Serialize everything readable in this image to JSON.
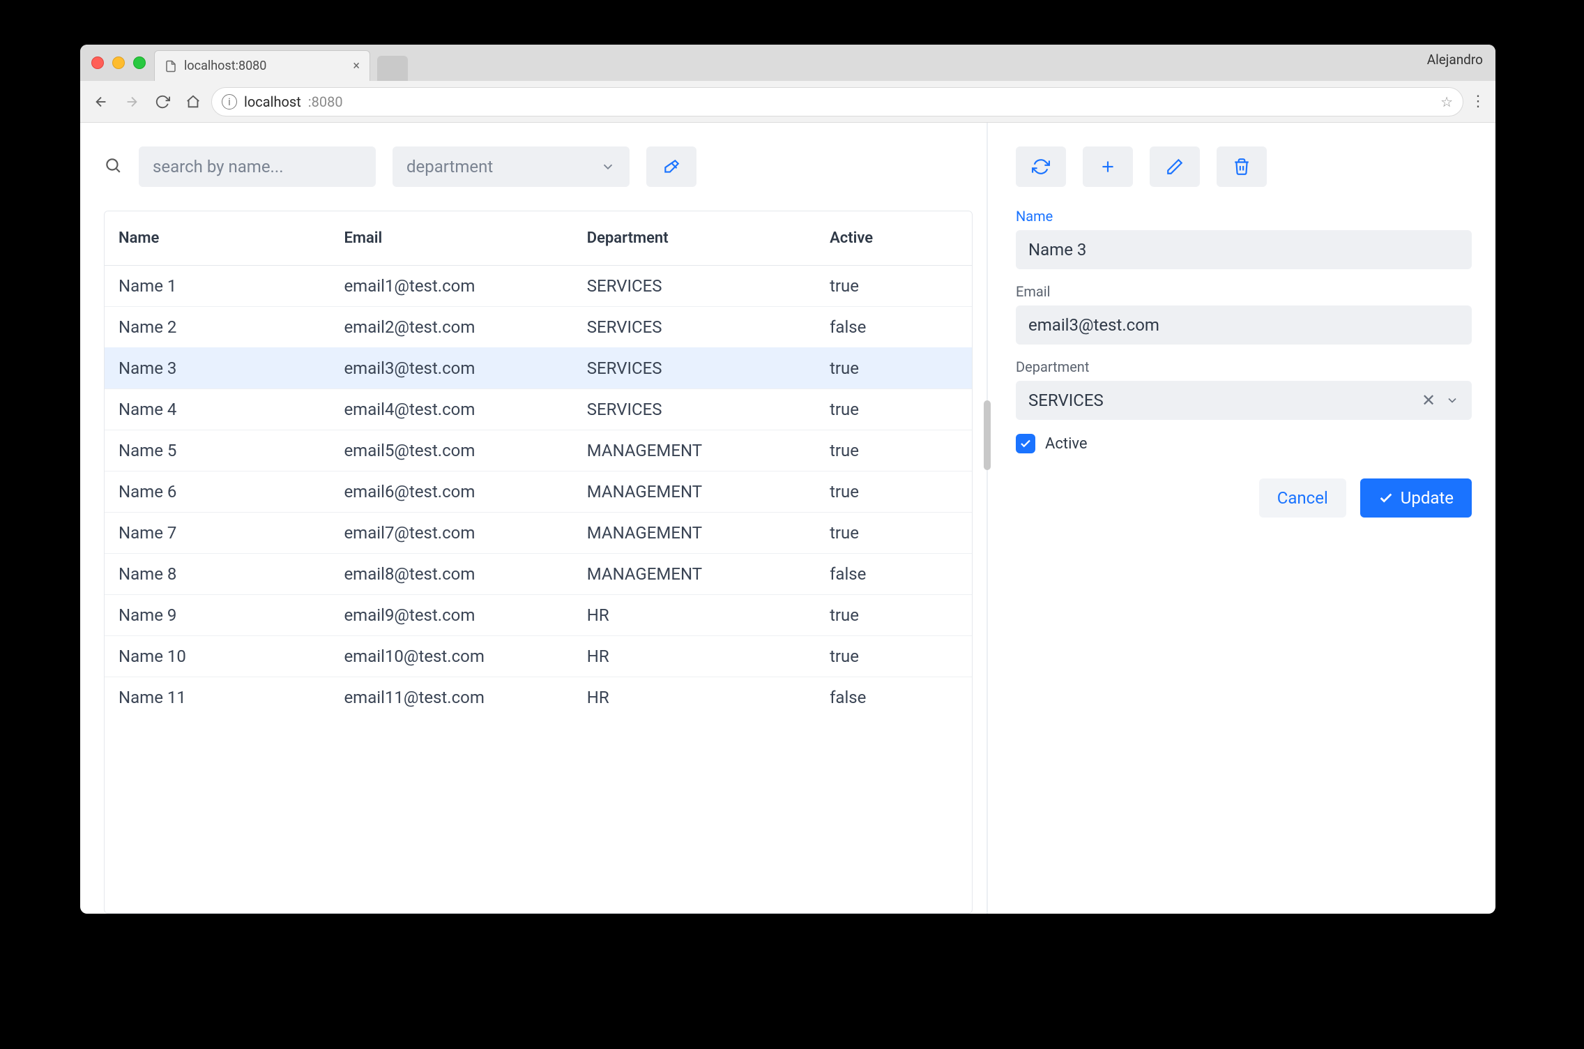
{
  "browser": {
    "tab_title": "localhost:8080",
    "profile_name": "Alejandro",
    "url_host": "localhost",
    "url_port": ":8080"
  },
  "toolbar": {
    "search_placeholder": "search by name...",
    "department_placeholder": "department"
  },
  "table": {
    "columns": [
      "Name",
      "Email",
      "Department",
      "Active"
    ],
    "selected_index": 2,
    "rows": [
      {
        "name": "Name 1",
        "email": "email1@test.com",
        "department": "SERVICES",
        "active": "true"
      },
      {
        "name": "Name 2",
        "email": "email2@test.com",
        "department": "SERVICES",
        "active": "false"
      },
      {
        "name": "Name 3",
        "email": "email3@test.com",
        "department": "SERVICES",
        "active": "true"
      },
      {
        "name": "Name 4",
        "email": "email4@test.com",
        "department": "SERVICES",
        "active": "true"
      },
      {
        "name": "Name 5",
        "email": "email5@test.com",
        "department": "MANAGEMENT",
        "active": "true"
      },
      {
        "name": "Name 6",
        "email": "email6@test.com",
        "department": "MANAGEMENT",
        "active": "true"
      },
      {
        "name": "Name 7",
        "email": "email7@test.com",
        "department": "MANAGEMENT",
        "active": "true"
      },
      {
        "name": "Name 8",
        "email": "email8@test.com",
        "department": "MANAGEMENT",
        "active": "false"
      },
      {
        "name": "Name 9",
        "email": "email9@test.com",
        "department": "HR",
        "active": "true"
      },
      {
        "name": "Name 10",
        "email": "email10@test.com",
        "department": "HR",
        "active": "true"
      },
      {
        "name": "Name 11",
        "email": "email11@test.com",
        "department": "HR",
        "active": "false"
      }
    ]
  },
  "form": {
    "labels": {
      "name": "Name",
      "email": "Email",
      "department": "Department",
      "active": "Active"
    },
    "values": {
      "name": "Name 3",
      "email": "email3@test.com",
      "department": "SERVICES",
      "active": true
    },
    "buttons": {
      "cancel": "Cancel",
      "update": "Update"
    }
  }
}
